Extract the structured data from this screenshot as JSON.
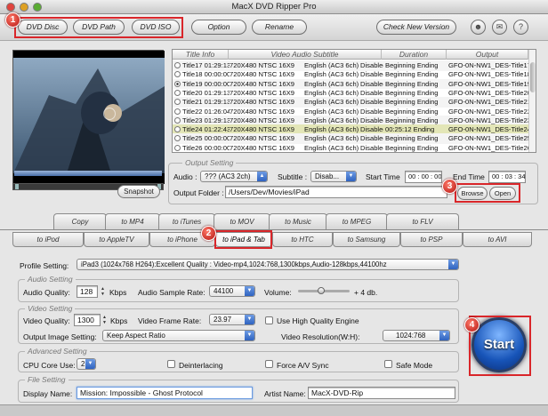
{
  "window": {
    "title": "MacX DVD Ripper Pro"
  },
  "toolbar": {
    "dvd_disc": "DVD Disc",
    "dvd_path": "DVD Path",
    "dvd_iso": "DVD ISO",
    "option": "Option",
    "rename": "Rename",
    "check_version": "Check New Version"
  },
  "badges": {
    "b1": "1",
    "b2": "2",
    "b3": "3",
    "b4": "4"
  },
  "preview": {
    "snapshot_label": "Snapshot"
  },
  "titles_table": {
    "headers": [
      "Title Info",
      "Video Audio Subtitle",
      "Duration",
      "Output"
    ],
    "rows": [
      {
        "title": "Title17",
        "time": "01:29:13",
        "video": "720X480 NTSC 16X9",
        "audio": "English (AC3 6ch)",
        "subtitle": "Disabled",
        "duration": "Beginning Ending",
        "output": "GFO-0N-NW1_DES-Title17",
        "selected": false
      },
      {
        "title": "Title18",
        "time": "00:00:00",
        "video": "720X480 NTSC 16X9",
        "audio": "English (AC3 6ch)",
        "subtitle": "Disabled",
        "duration": "Beginning Ending",
        "output": "GFO-0N-NW1_DES-Title18",
        "selected": false
      },
      {
        "title": "Title19",
        "time": "00:00:00",
        "video": "720X480 NTSC 16X9",
        "audio": "English (AC3 6ch)",
        "subtitle": "Disabled",
        "duration": "Beginning Ending",
        "output": "GFO-0N-NW1_DES-Title19",
        "selected": true
      },
      {
        "title": "Title20",
        "time": "01:29:13",
        "video": "720X480 NTSC 16X9",
        "audio": "English (AC3 6ch)",
        "subtitle": "Disabled",
        "duration": "Beginning Ending",
        "output": "GFO-0N-NW1_DES-Title20",
        "selected": false
      },
      {
        "title": "Title21",
        "time": "01:29:13",
        "video": "720X480 NTSC 16X9",
        "audio": "English (AC3 6ch)",
        "subtitle": "Disabled",
        "duration": "Beginning Ending",
        "output": "GFO-0N-NW1_DES-Title21",
        "selected": false
      },
      {
        "title": "Title22",
        "time": "01:26:04",
        "video": "720X480 NTSC 16X9",
        "audio": "English (AC3 6ch)",
        "subtitle": "Disabled",
        "duration": "Beginning Ending",
        "output": "GFO-0N-NW1_DES-Title22",
        "selected": false
      },
      {
        "title": "Title23",
        "time": "01:29:13",
        "video": "720X480 NTSC 16X9",
        "audio": "English (AC3 6ch)",
        "subtitle": "Disabled",
        "duration": "Beginning Ending",
        "output": "GFO-0N-NW1_DES-Title23",
        "selected": false
      },
      {
        "title": "Title24",
        "time": "01:22:43",
        "video": "720X480 NTSC 16X9",
        "audio": "English (AC3 6ch)",
        "subtitle": "Disabled",
        "duration": "00:25:12 Ending",
        "output": "GFO-0N-NW1_DES-Title24",
        "selected": false
      },
      {
        "title": "Title25",
        "time": "00:00:00",
        "video": "720X480 NTSC 16X9",
        "audio": "English (AC3 6ch)",
        "subtitle": "Disabled",
        "duration": "Beginning Ending",
        "output": "GFO-0N-NW1_DES-Title25",
        "selected": false
      },
      {
        "title": "Title26",
        "time": "00:00:00",
        "video": "720X480 NTSC 16X9",
        "audio": "English (AC3 6ch)",
        "subtitle": "Disabled",
        "duration": "Beginning Ending",
        "output": "GFO-0N-NW1_DES-Title26",
        "selected": false
      }
    ]
  },
  "output_setting": {
    "group_label": "Output Setting",
    "audio_label": "Audio :",
    "audio_value": "??? (AC3 2ch)",
    "subtitle_label": "Subtitle :",
    "subtitle_value": "Disab...",
    "start_time_label": "Start Time",
    "start_time_value": "00 : 00 : 00",
    "end_time_label": "End Time",
    "end_time_value": "00 : 03 : 34",
    "folder_label": "Output Folder :",
    "folder_value": "/Users/Dev/Movies/iPad",
    "browse": "Browse",
    "open": "Open"
  },
  "format_tabs": [
    "Copy",
    "to MP4",
    "to iTunes",
    "to MOV",
    "to Music",
    "to MPEG",
    "to FLV"
  ],
  "device_tabs": [
    "to iPod",
    "to AppleTV",
    "to iPhone",
    "to iPad & Tab",
    "to HTC",
    "to Samsung",
    "to PSP",
    "to AVI"
  ],
  "profile": {
    "label": "Profile Setting:",
    "value": "iPad3 (1024x768 H264):Excellent Quality : Video-mp4,1024:768,1300kbps,Audio-128kbps,44100hz"
  },
  "audio_setting": {
    "group_label": "Audio Setting",
    "quality_label": "Audio Quality:",
    "quality_value": "128",
    "quality_unit": "Kbps",
    "sample_rate_label": "Audio Sample Rate:",
    "sample_rate_value": "44100",
    "volume_label": "Volume:",
    "volume_value": "+ 4 db.",
    "volume_level": 0.45
  },
  "video_setting": {
    "group_label": "Video Setting",
    "quality_label": "Video Quality:",
    "quality_value": "1300",
    "quality_unit": "Kbps",
    "frame_rate_label": "Video Frame Rate:",
    "frame_rate_value": "23.97",
    "hq_engine_label": "Use High Quality Engine",
    "output_image_label": "Output Image Setting:",
    "output_image_value": "Keep Aspect Ratio",
    "resolution_label": "Video Resolution(W:H):",
    "resolution_value": "1024:768"
  },
  "advanced_setting": {
    "group_label": "Advanced Setting",
    "cpu_label": "CPU Core Use:",
    "cpu_value": "2",
    "deinterlacing_label": "Deinterlacing",
    "force_av_label": "Force A/V Sync",
    "safe_mode_label": "Safe Mode"
  },
  "file_setting": {
    "group_label": "File Setting",
    "display_name_label": "Display Name:",
    "display_name_value": "Mission: Impossible - Ghost Protocol",
    "artist_name_label": "Artist Name:",
    "artist_name_value": "MacX-DVD-Rip"
  },
  "start_button": {
    "label": "Start"
  },
  "colors": {
    "accent_red": "#d9262a",
    "start_blue": "#1754b8"
  }
}
